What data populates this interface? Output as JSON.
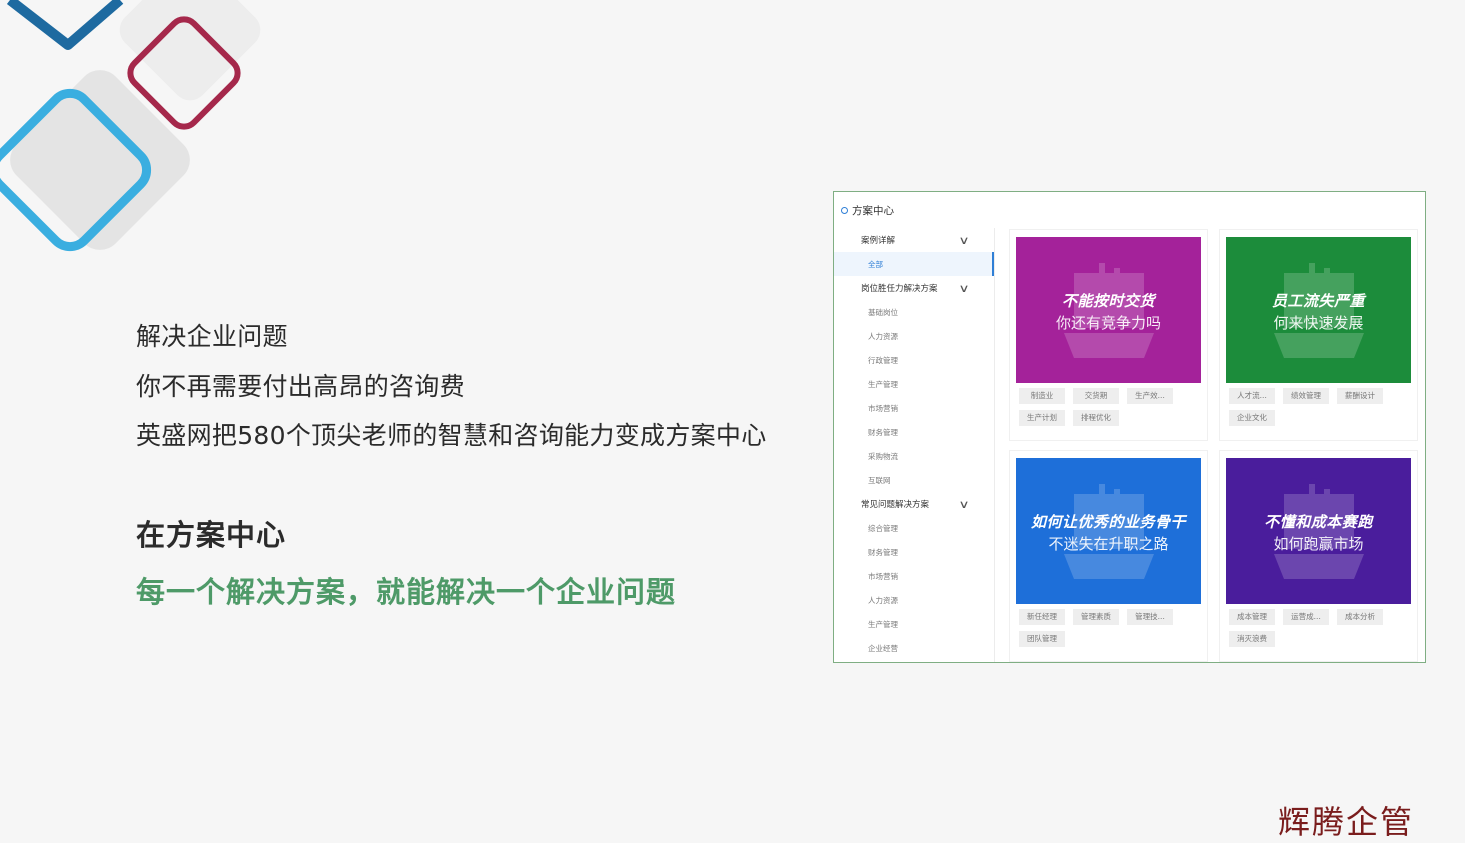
{
  "intro": {
    "line1": "解决企业问题",
    "line2": "你不再需要付出高昂的咨询费",
    "line3": "英盛网把580个顶尖老师的智慧和咨询能力变成方案中心"
  },
  "highlight": {
    "title": "在方案中心",
    "subtitle": "每一个解决方案，就能解决一个企业问题"
  },
  "panel": {
    "title": "方案中心",
    "sidebar": {
      "groups": [
        {
          "label": "案例详解",
          "items": [
            "全部"
          ]
        },
        {
          "label": "岗位胜任力解决方案",
          "items": [
            "基础岗位",
            "人力资源",
            "行政管理",
            "生产管理",
            "市场营销",
            "财务管理",
            "采购物流",
            "互联网"
          ]
        },
        {
          "label": "常见问题解决方案",
          "items": [
            "综合管理",
            "财务管理",
            "市场营销",
            "人力资源",
            "生产管理",
            "企业经营"
          ]
        }
      ]
    },
    "cards": [
      {
        "title": "不能按时交货",
        "subtitle": "你还有竞争力吗",
        "color": "#a4229a",
        "tags": [
          "制造业",
          "交货期",
          "生产效...",
          "生产计划",
          "排程优化"
        ]
      },
      {
        "title": "员工流失严重",
        "subtitle": "何来快速发展",
        "color": "#1c8c3b",
        "tags": [
          "人才流...",
          "绩效管理",
          "薪酬设计",
          "企业文化"
        ]
      },
      {
        "title": "如何让优秀的业务骨干",
        "subtitle": "不迷失在升职之路",
        "color": "#1e6fd9",
        "tags": [
          "新任经理",
          "管理素质",
          "管理技...",
          "团队管理"
        ]
      },
      {
        "title": "不懂和成本赛跑",
        "subtitle": "如何跑赢市场",
        "color": "#4a1d9c",
        "tags": [
          "成本管理",
          "运营成...",
          "成本分析",
          "消灭浪费"
        ]
      }
    ]
  },
  "corner_mark": "辉腾企管",
  "colors": {
    "accent_green": "#4e9a68",
    "panel_border": "#7fae83",
    "link_blue": "#2f7fd6"
  }
}
